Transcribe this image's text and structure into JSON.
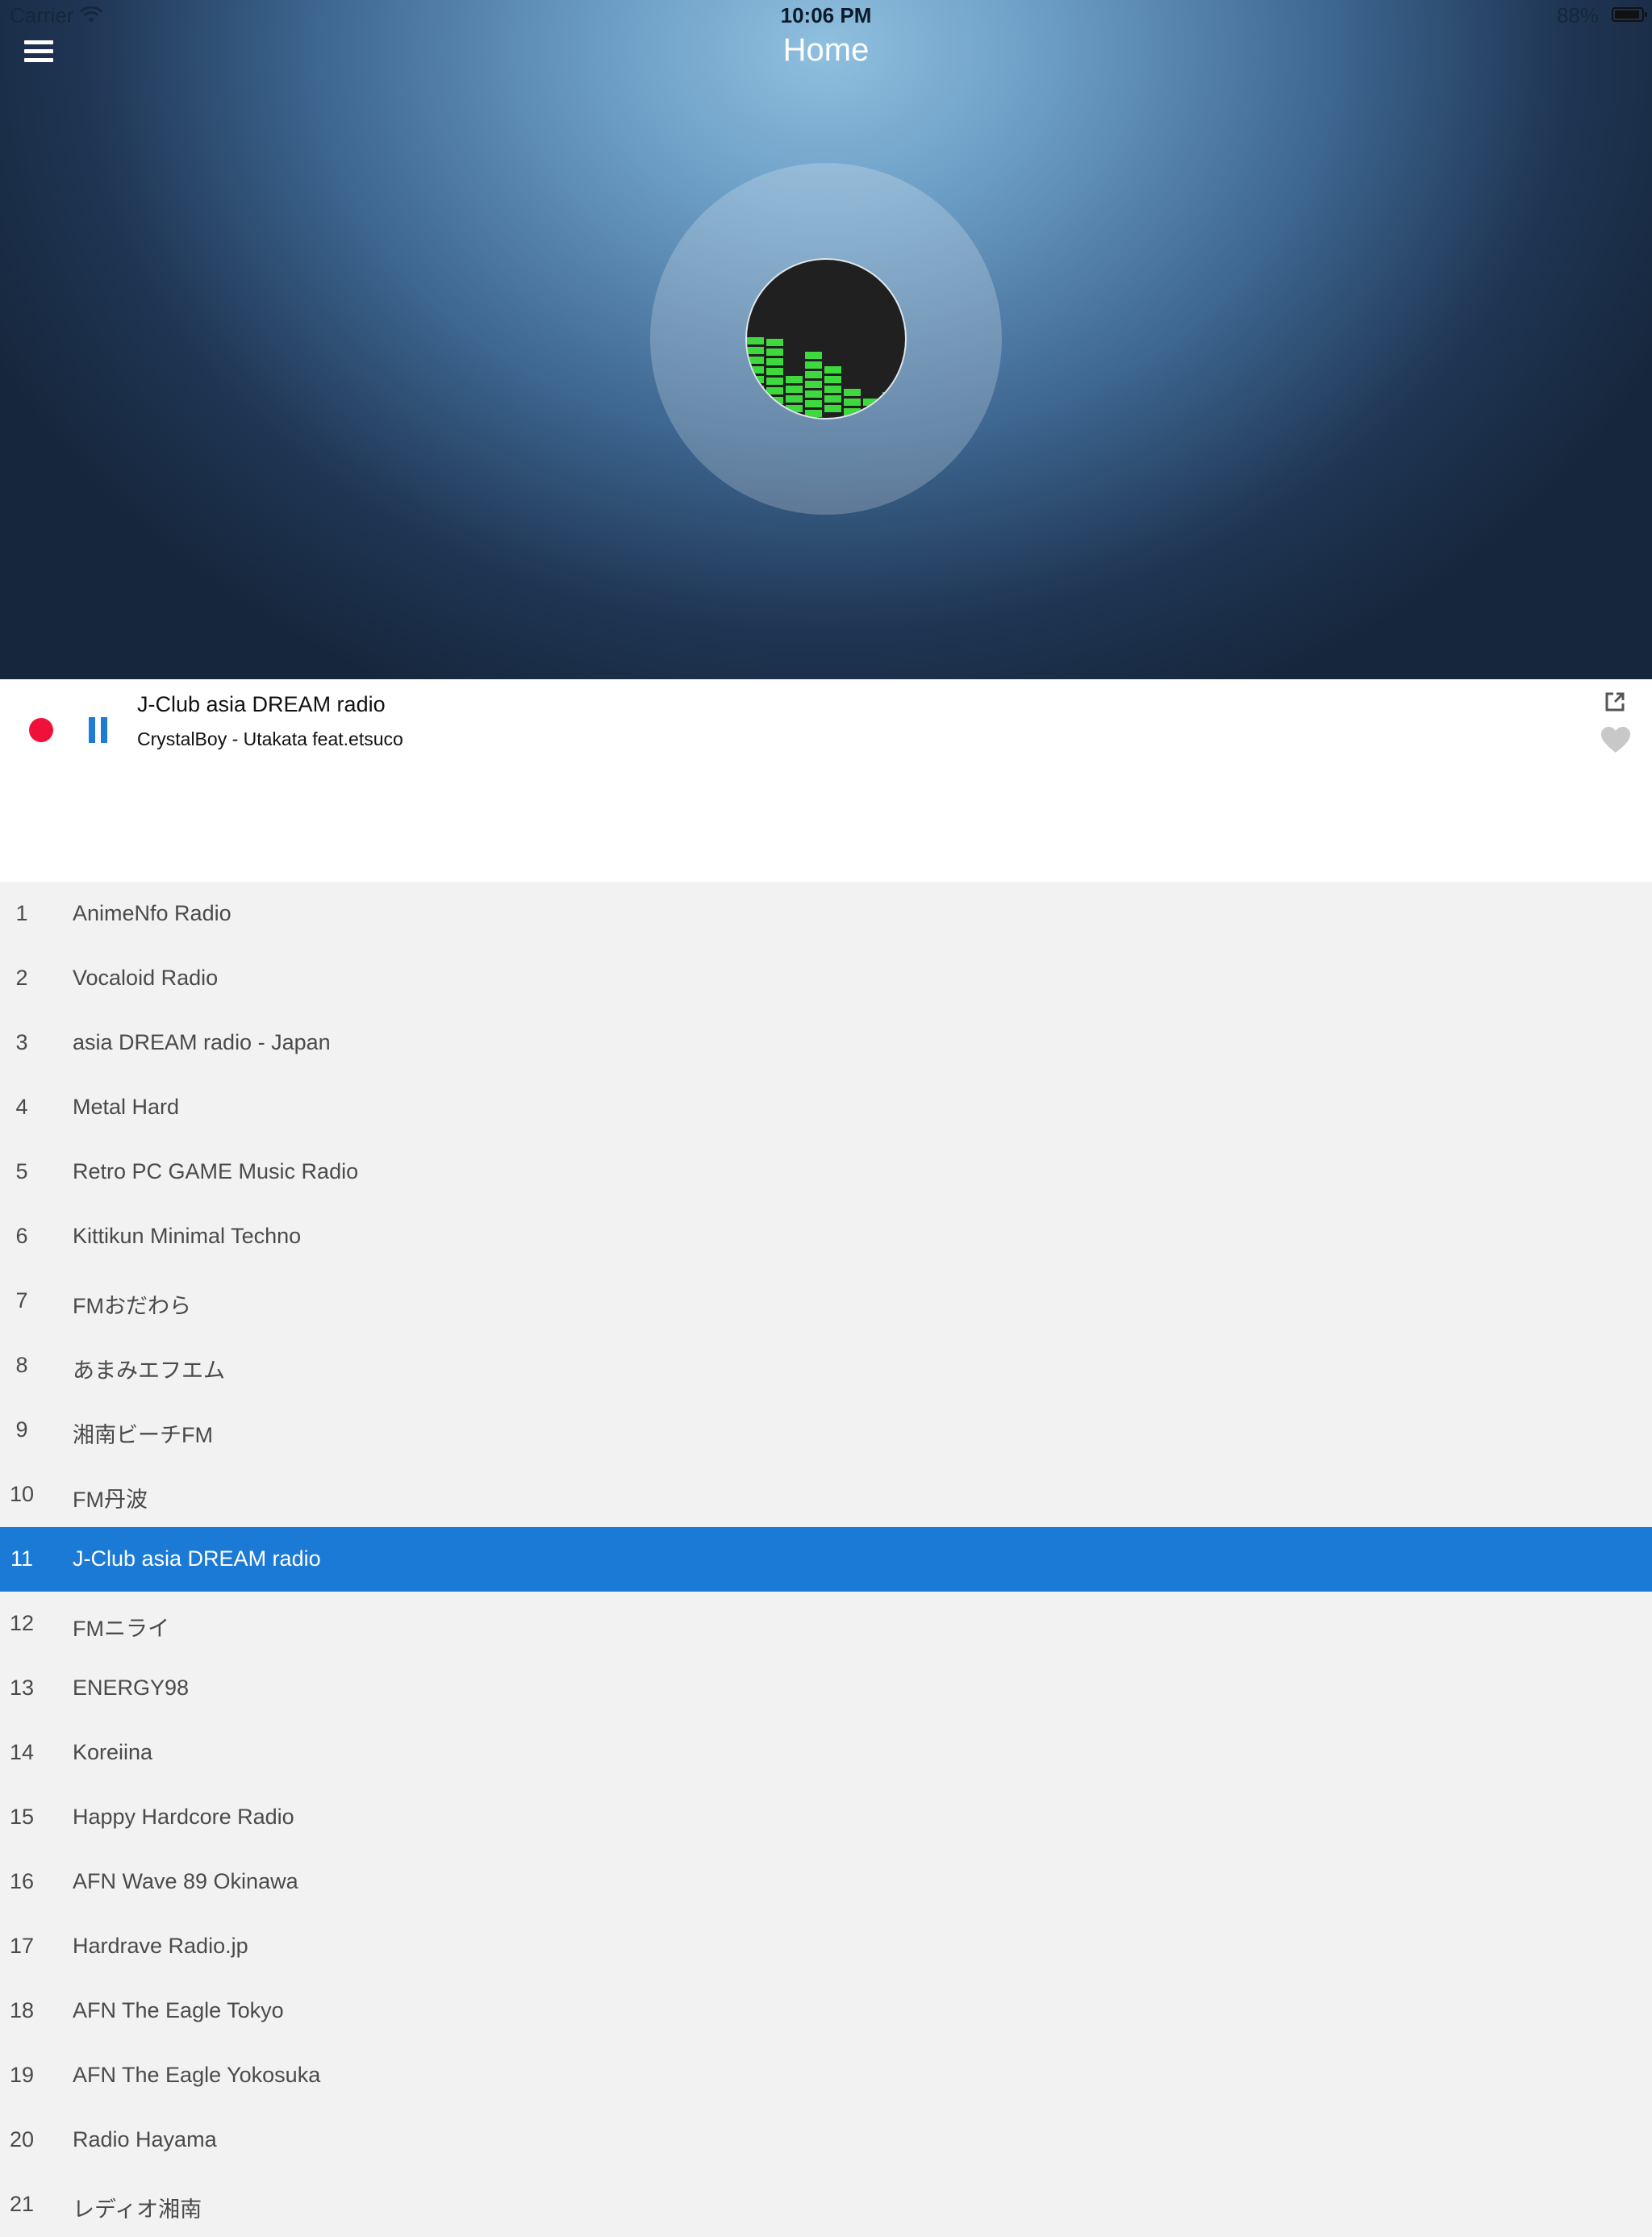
{
  "status_bar": {
    "carrier": "Carrier",
    "time": "10:06 PM",
    "battery": "88%"
  },
  "nav": {
    "title": "Home",
    "menu_icon": "hamburger-menu-icon"
  },
  "now_playing": {
    "station": "J-Club asia DREAM radio",
    "track": "CrystalBoy - Utakata feat.etsuco",
    "record_color": "#f0113a",
    "accent_color": "#1f7bd4"
  },
  "stations": [
    {
      "num": "1",
      "name": "AnimeNfo Radio"
    },
    {
      "num": "2",
      "name": "Vocaloid Radio"
    },
    {
      "num": "3",
      "name": "asia DREAM radio - Japan"
    },
    {
      "num": "4",
      "name": "Metal Hard"
    },
    {
      "num": "5",
      "name": "Retro PC GAME Music Radio"
    },
    {
      "num": "6",
      "name": "Kittikun Minimal Techno"
    },
    {
      "num": "7",
      "name": "FMおだわら"
    },
    {
      "num": "8",
      "name": "あまみエフエム"
    },
    {
      "num": "9",
      "name": "湘南ビーチFM"
    },
    {
      "num": "10",
      "name": "FM丹波"
    },
    {
      "num": "11",
      "name": "J-Club asia DREAM radio",
      "selected": true
    },
    {
      "num": "12",
      "name": "FMニライ"
    },
    {
      "num": "13",
      "name": "ENERGY98"
    },
    {
      "num": "14",
      "name": "Koreiina"
    },
    {
      "num": "15",
      "name": "Happy Hardcore Radio"
    },
    {
      "num": "16",
      "name": "AFN Wave 89 Okinawa"
    },
    {
      "num": "17",
      "name": "Hardrave Radio.jp"
    },
    {
      "num": "18",
      "name": "AFN The Eagle Tokyo"
    },
    {
      "num": "19",
      "name": "AFN The Eagle Yokosuka"
    },
    {
      "num": "20",
      "name": "Radio Hayama"
    },
    {
      "num": "21",
      "name": "レディオ湘南"
    }
  ],
  "selected_color": "#1b7ad5"
}
